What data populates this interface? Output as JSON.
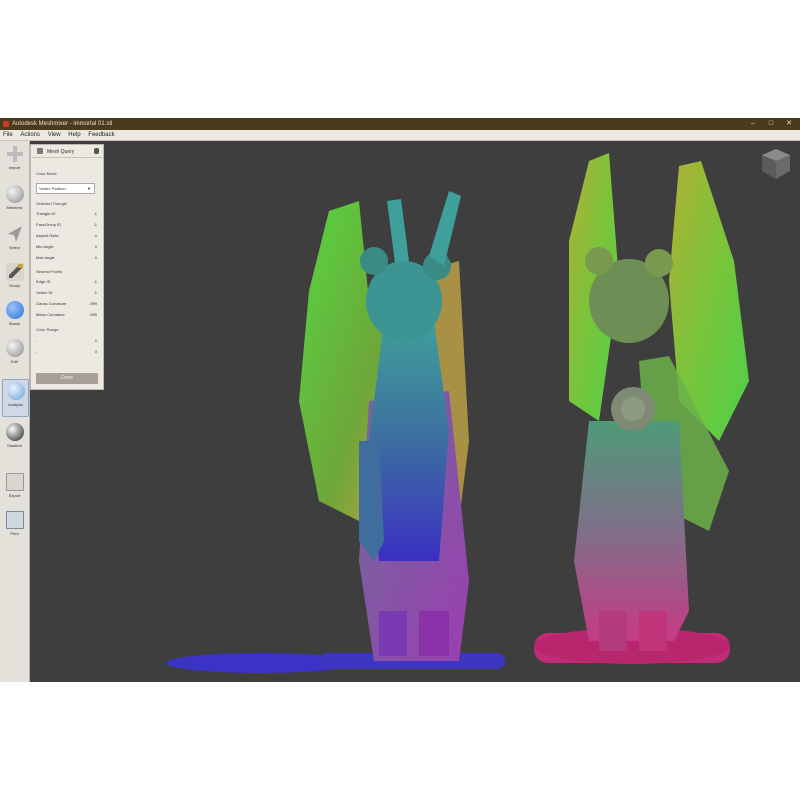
{
  "window": {
    "title": "Autodesk Meshmixer - immortal 01.stl",
    "minimize": "–",
    "maximize": "□",
    "close": "✕"
  },
  "menu": [
    "File",
    "Actions",
    "View",
    "Help",
    "Feedback"
  ],
  "toolbar": [
    {
      "name": "import",
      "label": "Import",
      "icon": "plus-icon"
    },
    {
      "name": "meshmix",
      "label": "Meshmix",
      "icon": "sphere-icon"
    },
    {
      "name": "select",
      "label": "Select",
      "icon": "arrow-icon"
    },
    {
      "name": "sculpt",
      "label": "Sculpt",
      "icon": "brush-icon"
    },
    {
      "name": "stamp",
      "label": "Stamp",
      "icon": "stamp-icon"
    },
    {
      "name": "edit",
      "label": "Edit",
      "icon": "edit-icon"
    },
    {
      "name": "analysis",
      "label": "Analysis",
      "icon": "analysis-icon"
    },
    {
      "name": "shaders",
      "label": "Shaders",
      "icon": "shader-icon"
    },
    {
      "name": "export",
      "label": "Export",
      "icon": "export-icon"
    },
    {
      "name": "print",
      "label": "Print",
      "icon": "print-icon"
    }
  ],
  "active_tool": "analysis",
  "panel": {
    "title": "Mesh Query",
    "color_mode_label": "Color Mode",
    "color_mode_value": "Vertex Position",
    "selected_triangle_label": "Selected Triangle",
    "selected_rows": [
      {
        "k": "Triangle ID",
        "v": "-1"
      },
      {
        "k": "FaceGroup ID",
        "v": "-1"
      },
      {
        "k": "Aspect Ratio",
        "v": "0"
      },
      {
        "k": "Min Angle",
        "v": "0"
      },
      {
        "k": "Max Angle",
        "v": "0"
      }
    ],
    "nearest_points_label": "Nearest Points",
    "nearest_rows": [
      {
        "k": "Edge ID",
        "v": "-1"
      },
      {
        "k": "Vertex ID",
        "v": "-1"
      },
      {
        "k": "Gauss Curvature",
        "v": "-999"
      },
      {
        "k": "Mean Curvature",
        "v": "-999"
      }
    ],
    "color_range_label": "Color Range",
    "range_rows": [
      {
        "k": "-",
        "v": "0"
      },
      {
        "k": "-",
        "v": "0"
      }
    ],
    "done_label": "Done"
  },
  "colors": {
    "titlebar": "#4a3a1e",
    "viewport": "#3e3e3e",
    "panel": "#ece9e3",
    "done_button": "#a89f96"
  }
}
